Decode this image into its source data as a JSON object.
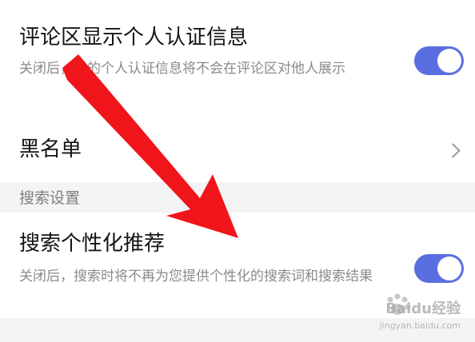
{
  "settings": {
    "comment_certification": {
      "title": "评论区显示个人认证信息",
      "description": "关闭后，你的个人认证信息将不会在评论区对他人展示",
      "enabled": true
    },
    "blacklist": {
      "title": "黑名单"
    },
    "search_section": {
      "header": "搜索设置"
    },
    "personalized_search": {
      "title": "搜索个性化推荐",
      "description": "关闭后，搜索时将不再为您提供个性化的搜索词和搜索结果",
      "enabled": true
    }
  },
  "colors": {
    "toggle_on": "#5b6ee1",
    "arrow": "#f0151b",
    "section_background": "#f4f4f4"
  },
  "watermark": {
    "brand": "Baidu经验",
    "url": "jingyan.baidu.com"
  }
}
